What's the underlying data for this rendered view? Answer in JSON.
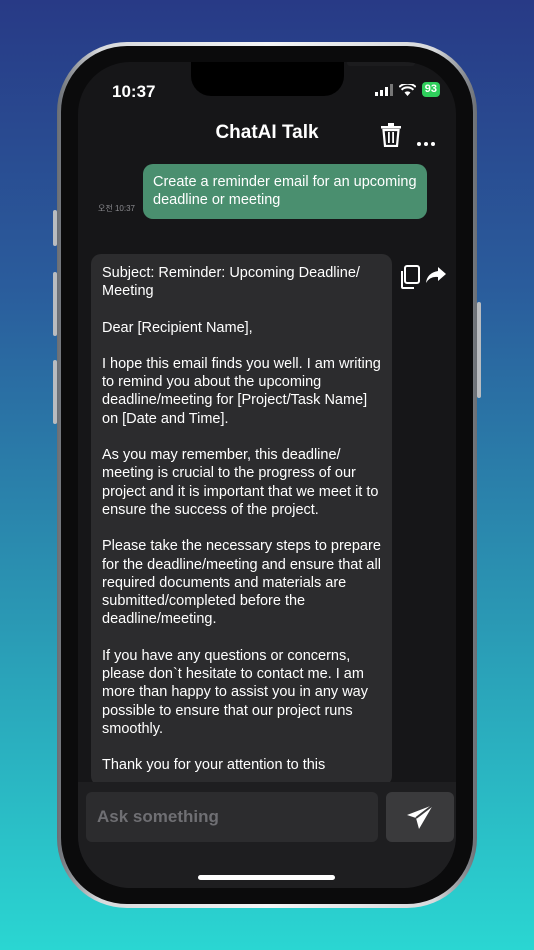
{
  "status_bar": {
    "time": "10:37",
    "battery": "93"
  },
  "header": {
    "title": "ChatAI Talk"
  },
  "conversation": {
    "user_message": {
      "text": "Create a reminder email for an upcoming deadline or meeting",
      "time": "오전 10:37"
    },
    "ai_message": {
      "paragraphs": [
        "Subject: Reminder: Upcoming Deadline/ Meeting",
        "Dear [Recipient Name],",
        "I hope this email finds you well. I am writing to remind you about the upcoming deadline/meeting for [Project/Task Name] on [Date and Time].",
        "As you may remember, this deadline/ meeting is crucial to the progress of our project and it is important that we meet it to ensure the success of the project.",
        "Please take the necessary steps to prepare for the deadline/meeting and ensure that all required documents and materials are submitted/completed before the deadline/meeting.",
        "If you have any questions or concerns, please don`t hesitate to contact me. I am more than happy to assist you in any way possible to ensure that our project runs smoothly.",
        "Thank you for your attention to this"
      ]
    }
  },
  "composer": {
    "placeholder": "Ask something"
  },
  "icons": {
    "trash": "trash-icon",
    "more": "more-icon",
    "copy": "copy-icon",
    "share": "share-icon",
    "send": "send-icon",
    "signal": "signal-icon",
    "wifi": "wifi-icon"
  },
  "colors": {
    "user_bubble": "#4a8f6f",
    "ai_bubble": "#2c2c2e",
    "battery": "#2fcf5c"
  }
}
